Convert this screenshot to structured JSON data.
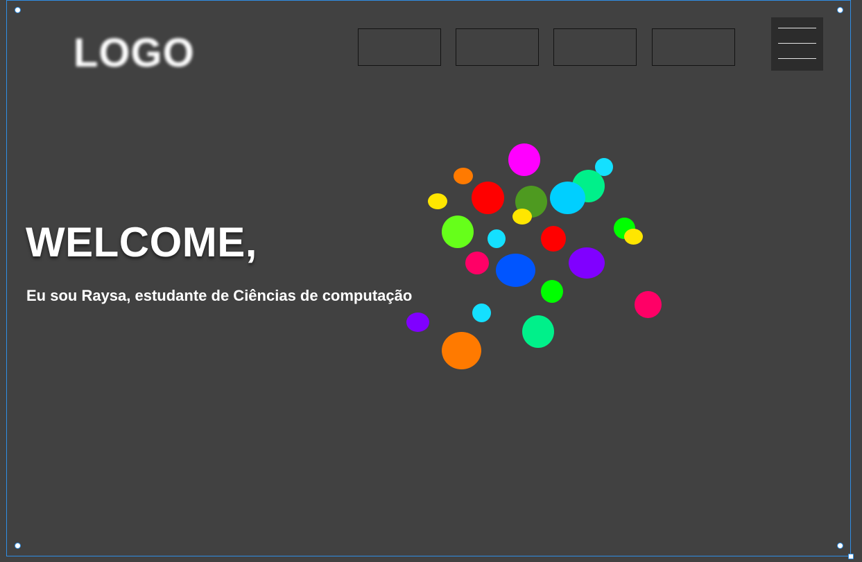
{
  "header": {
    "logo_text": "LOGO",
    "nav_items": [
      "",
      "",
      "",
      ""
    ],
    "menu_icon": "hamburger-menu-icon"
  },
  "hero": {
    "title": "WELCOME,",
    "subtitle": "Eu sou Raysa, estudante de Ciências de computação"
  },
  "colors": {
    "background": "#414141",
    "selection": "#2f8fe6",
    "menu_button": "#2c2c2c"
  },
  "decoration": {
    "type": "colorful-dots-cluster",
    "palette": [
      "#ff00ff",
      "#ff7a00",
      "#ffe600",
      "#ff0000",
      "#4e9a20",
      "#00cfff",
      "#00f08a",
      "#14e0ff",
      "#66ff1a",
      "#ff0066",
      "#0055ff",
      "#8000ff",
      "#00ff00"
    ]
  }
}
